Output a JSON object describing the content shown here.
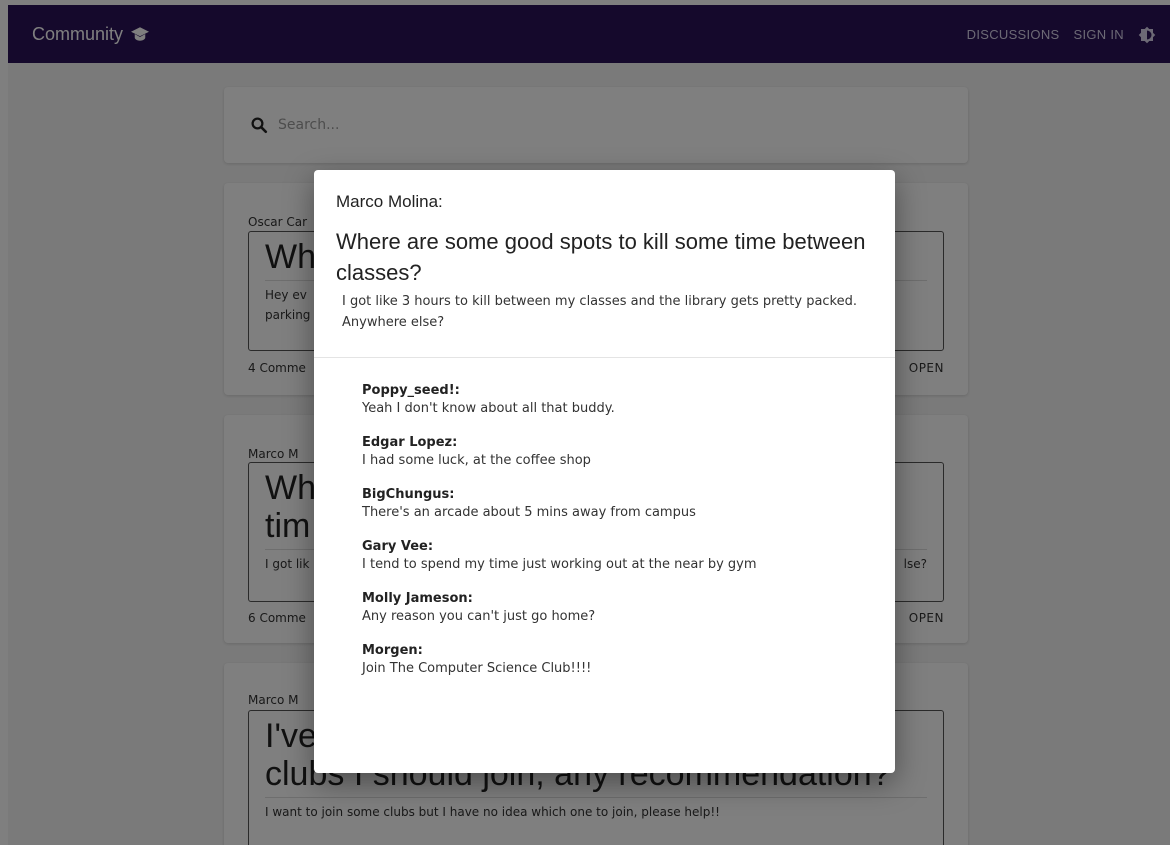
{
  "appbar": {
    "title": "Community",
    "nav": {
      "discussions": "DISCUSSIONS",
      "sign_in": "SIGN IN"
    },
    "bg_color": "#2a1259"
  },
  "search": {
    "placeholder": "Search..."
  },
  "posts": [
    {
      "author": "Oscar Car",
      "title": "Wh",
      "body_line1": "Hey ev",
      "body_line2": "parking",
      "comments": "4 Comme",
      "action": "OPEN"
    },
    {
      "author": "Marco M",
      "title_line1": "Wh",
      "title_line2": "tim",
      "body": "I got lik",
      "body_tail": "lse?",
      "comments": "6 Comme",
      "action": "OPEN"
    },
    {
      "author": "Marco M",
      "title_line1": "I've",
      "title_line2": "clubs I should join, any recommendation?",
      "body": "I want to join some clubs but I have no idea which one to join, please help!!"
    }
  ],
  "modal": {
    "author": "Marco Molina:",
    "title": "Where are some good spots to kill some time between classes?",
    "body": "I got like 3 hours to kill between my classes and the library gets pretty packed. Anywhere else?",
    "comments": [
      {
        "user": "Poppy_seed!:",
        "text": "Yeah I don't know about all that buddy."
      },
      {
        "user": "Edgar Lopez:",
        "text": "I had some luck, at the coffee shop"
      },
      {
        "user": "BigChungus:",
        "text": "There's an arcade about 5 mins away from campus"
      },
      {
        "user": "Gary Vee:",
        "text": "I tend to spend my time just working out at the near by gym"
      },
      {
        "user": "Molly Jameson:",
        "text": "Any reason you can't just go home?"
      },
      {
        "user": "Morgen:",
        "text": "Join The Computer Science Club!!!!"
      }
    ]
  }
}
